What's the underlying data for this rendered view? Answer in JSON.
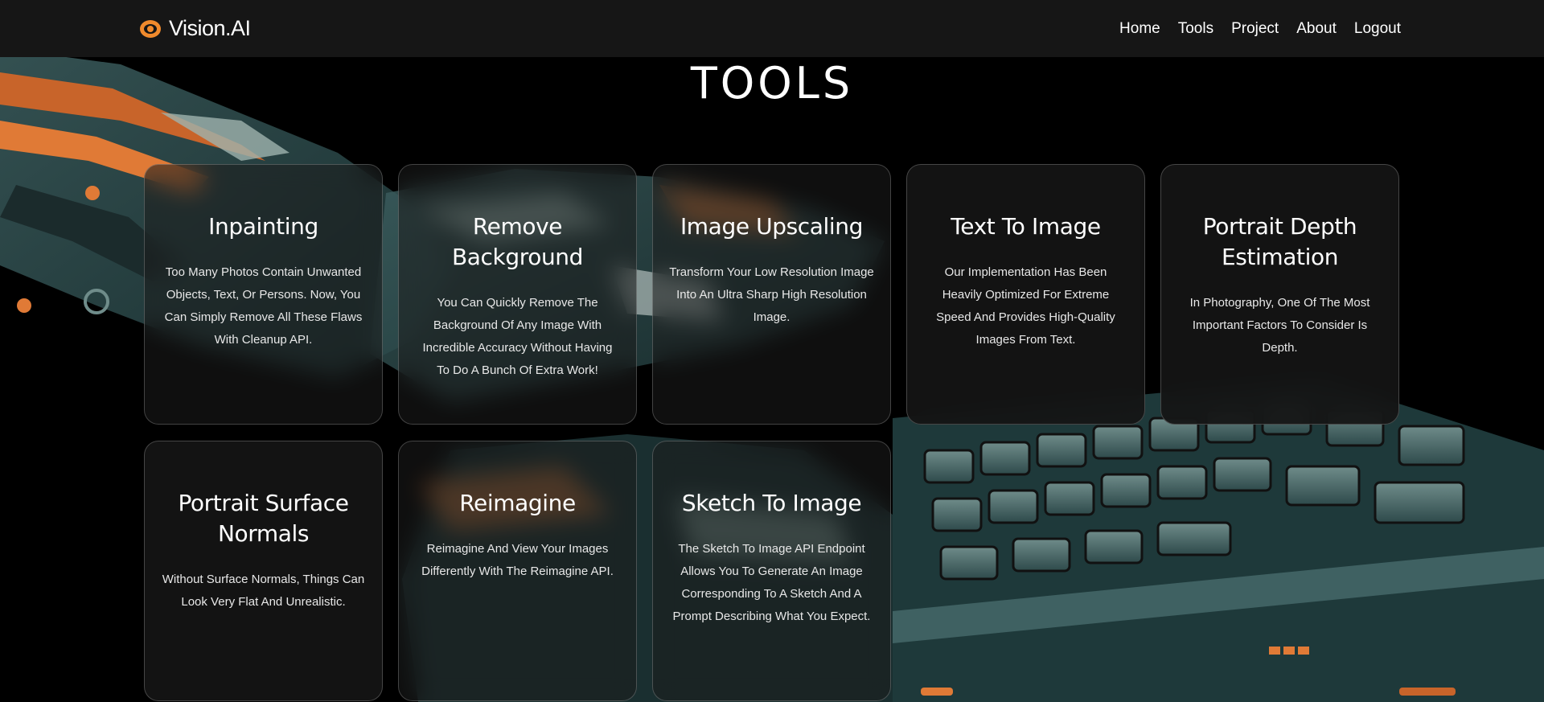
{
  "brand": {
    "name": "Vision.AI",
    "icon": "eye-icon",
    "accent": "#f08a2c"
  },
  "nav": {
    "items": [
      {
        "label": "Home"
      },
      {
        "label": "Tools"
      },
      {
        "label": "Project"
      },
      {
        "label": "About"
      },
      {
        "label": "Logout"
      }
    ]
  },
  "page": {
    "title": "TOOLS"
  },
  "tools": [
    {
      "title": "Inpainting",
      "description": "Too Many Photos Contain Unwanted Objects, Text, Or Persons. Now, You Can Simply Remove All These Flaws With Cleanup API."
    },
    {
      "title": "Remove Background",
      "description": "You Can Quickly Remove The Background Of Any Image With Incredible Accuracy Without Having To Do A Bunch Of Extra Work!"
    },
    {
      "title": "Image Upscaling",
      "description": "Transform Your Low Resolution Image Into An Ultra Sharp High Resolution Image."
    },
    {
      "title": "Text To Image",
      "description": "Our Implementation Has Been Heavily Optimized For Extreme Speed And Provides High-Quality Images From Text."
    },
    {
      "title": "Portrait Depth Estimation",
      "description": "In Photography, One Of The Most Important Factors To Consider Is Depth."
    },
    {
      "title": "Portrait Surface Normals",
      "description": "Without Surface Normals, Things Can Look Very Flat And Unrealistic."
    },
    {
      "title": "Reimagine",
      "description": "Reimagine And View Your Images Differently With The Reimagine API."
    },
    {
      "title": "Sketch To Image",
      "description": "The Sketch To Image API Endpoint Allows You To Generate An Image Corresponding To A Sketch And A Prompt Describing What You Expect."
    }
  ]
}
